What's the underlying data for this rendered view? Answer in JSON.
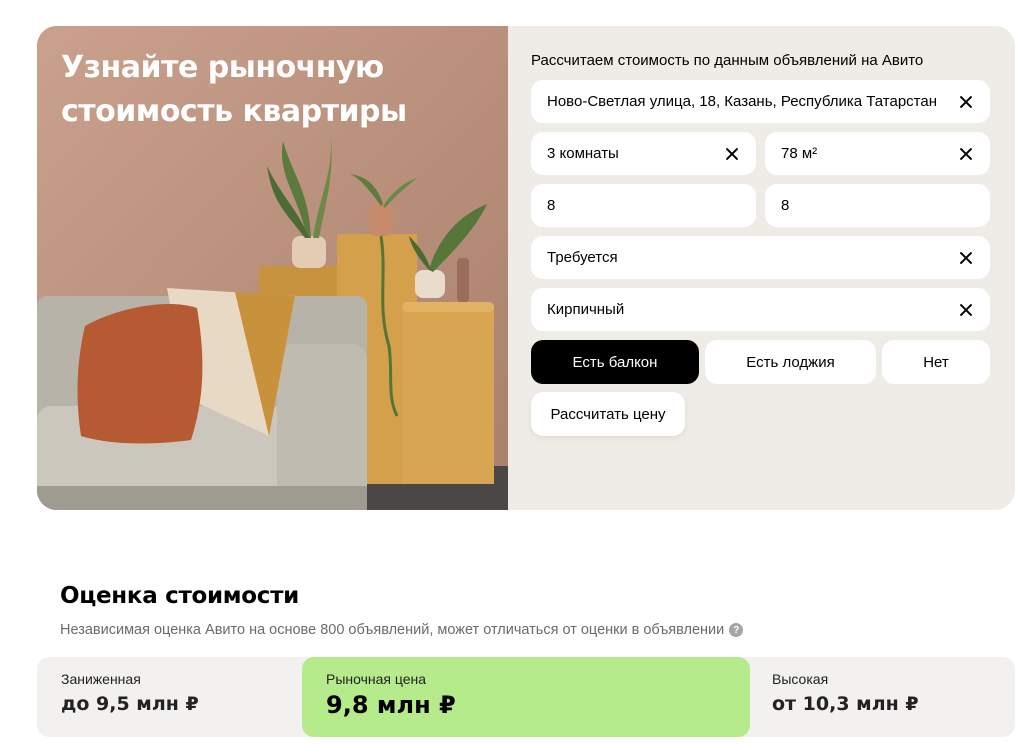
{
  "hero": {
    "title": "Узнайте рыночную стоимость квартиры"
  },
  "form": {
    "caption": "Рассчитаем стоимость по данным объявлений на Авито",
    "address": "Ново-Светлая улица, 18, Казань, Республика Татарстан",
    "rooms": "3 комнаты",
    "area": "78 м²",
    "floor": "8",
    "floors_total": "8",
    "repair": "Требуется",
    "house_type": "Кирпичный",
    "balcony_options": [
      "Есть балкон",
      "Есть лоджия",
      "Нет"
    ],
    "balcony_selected": "Есть балкон",
    "submit_label": "Рассчитать цену"
  },
  "estimate": {
    "title": "Оценка стоимости",
    "subtitle": "Независимая оценка Авито на основе 800 объявлений, может отличаться от оценки в объявлении",
    "help_icon": "?",
    "low_label": "Заниженная",
    "low_value": "до 9,5 млн ₽",
    "market_label": "Рыночная цена",
    "market_value": "9,8 млн ₽",
    "high_label": "Высокая",
    "high_value": "от 10,3 млн ₽"
  },
  "colors": {
    "active_segment": "#000000",
    "market_price_bg": "#b5eb8a",
    "form_bg": "#efebe6"
  }
}
